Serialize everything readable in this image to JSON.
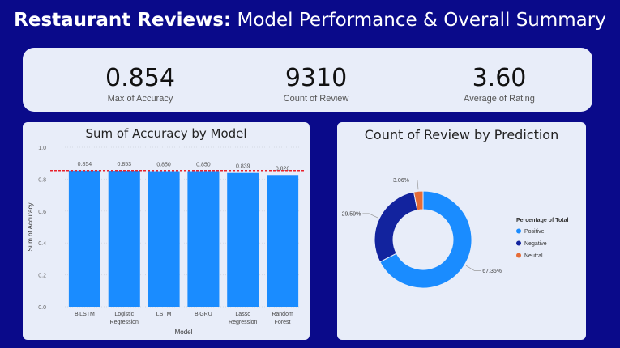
{
  "header": {
    "title_bold": "Restaurant Reviews:",
    "title_rest": "Model Performance & Overall Summary"
  },
  "kpis": [
    {
      "value": "0.854",
      "label": "Max of Accuracy"
    },
    {
      "value": "9310",
      "label": "Count of Review"
    },
    {
      "value": "3.60",
      "label": "Average of Rating"
    }
  ],
  "bar_card": {
    "title": "Sum of Accuracy by Model"
  },
  "donut_card": {
    "title": "Count of Review by Prediction"
  },
  "colors": {
    "bar": "#1a8cff",
    "positive": "#1a8cff",
    "negative": "#12239e",
    "neutral": "#e66c37",
    "max_line": "#e8202a"
  },
  "chart_data": [
    {
      "type": "bar",
      "title": "Sum of Accuracy by Model",
      "xlabel": "Model",
      "ylabel": "Sum of Accuracy",
      "categories": [
        "BiLSTM",
        "Logistic\nRegression",
        "LSTM",
        "BiGRU",
        "Lasso\nRegression",
        "Random\nForest"
      ],
      "values": [
        0.854,
        0.853,
        0.85,
        0.85,
        0.839,
        0.826
      ],
      "data_labels": [
        "0.854",
        "0.853",
        "0.850",
        "0.850",
        "0.839",
        "0.826"
      ],
      "ylim": [
        0,
        1.0
      ],
      "yticks": [
        "0.0",
        "0.2",
        "0.4",
        "0.6",
        "0.8",
        "1.0"
      ],
      "reference_line": 0.854,
      "grid": true
    },
    {
      "type": "pie",
      "title": "Count of Review by Prediction",
      "legend_title": "Percentage of Total",
      "legend_position": "right",
      "categories": [
        "Positive",
        "Negative",
        "Neutral"
      ],
      "values": [
        67.35,
        29.59,
        3.06
      ],
      "data_labels": [
        "67.35%",
        "29.59%",
        "3.06%"
      ]
    }
  ]
}
